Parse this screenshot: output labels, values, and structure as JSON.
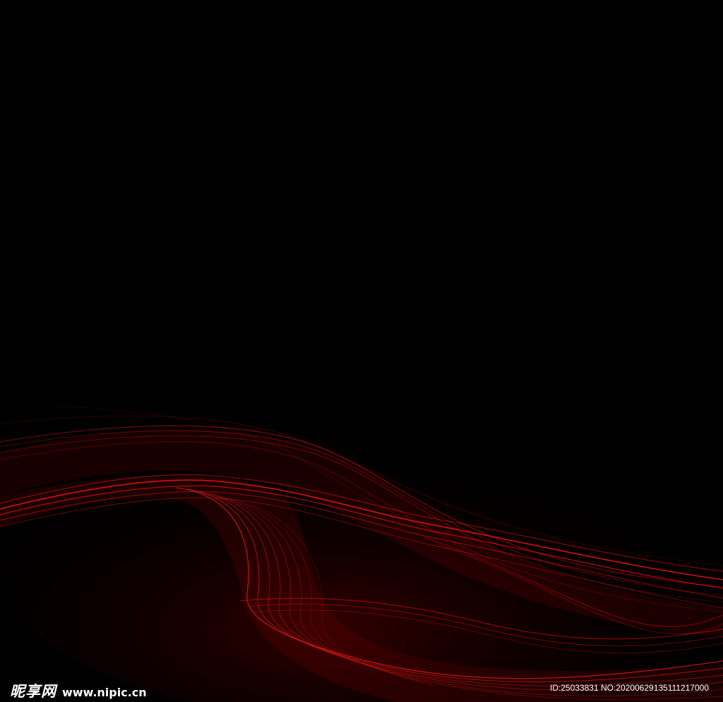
{
  "scene": {
    "background_color": "#000000",
    "accent_color": "#e00000",
    "subject": "red-wave-lines-icon"
  },
  "watermark": {
    "brand": "昵享网",
    "url": "www.nipic.cn",
    "id_text": "ID:25033831 NO:20200629135111217000"
  }
}
